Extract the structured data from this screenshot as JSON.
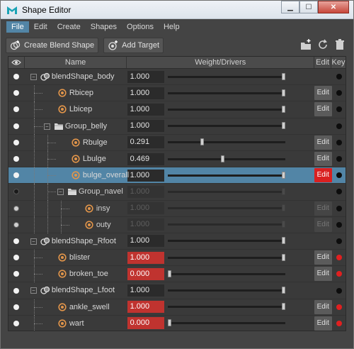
{
  "window": {
    "title": "Shape Editor"
  },
  "menu": [
    {
      "label": "File",
      "active": true
    },
    {
      "label": "Edit",
      "active": false
    },
    {
      "label": "Create",
      "active": false
    },
    {
      "label": "Shapes",
      "active": false
    },
    {
      "label": "Options",
      "active": false
    },
    {
      "label": "Help",
      "active": false
    }
  ],
  "toolbar": {
    "create_blend_shape": "Create Blend Shape",
    "add_target": "Add Target"
  },
  "columns": {
    "name": "Name",
    "weight": "Weight/Drivers",
    "edit": "Edit",
    "key": "Key"
  },
  "edit_label": "Edit",
  "rows": [
    {
      "name": "blendShape_body",
      "type": "blendshape",
      "depth": 0,
      "weight": "1.000",
      "slider": 1.0,
      "visible": "on",
      "edit": "none",
      "key": "black",
      "expand": "minus"
    },
    {
      "name": "Rbicep",
      "type": "target",
      "depth": 1,
      "weight": "1.000",
      "slider": 1.0,
      "visible": "on",
      "edit": "normal",
      "key": "black"
    },
    {
      "name": "Lbicep",
      "type": "target",
      "depth": 1,
      "weight": "1.000",
      "slider": 1.0,
      "visible": "on",
      "edit": "normal",
      "key": "black"
    },
    {
      "name": "Group_belly",
      "type": "group",
      "depth": 1,
      "weight": "1.000",
      "slider": 1.0,
      "visible": "on",
      "edit": "none",
      "key": "black",
      "expand": "minus"
    },
    {
      "name": "Rbulge",
      "type": "target",
      "depth": 2,
      "weight": "0.291",
      "slider": 0.291,
      "visible": "on",
      "edit": "normal",
      "key": "black"
    },
    {
      "name": "Lbulge",
      "type": "target",
      "depth": 2,
      "weight": "0.469",
      "slider": 0.469,
      "visible": "on",
      "edit": "normal",
      "key": "black"
    },
    {
      "name": "bulge_overall",
      "type": "target",
      "depth": 2,
      "weight": "1.000",
      "slider": 1.0,
      "visible": "on",
      "edit": "active",
      "key": "black",
      "selected": true
    },
    {
      "name": "Group_navel",
      "type": "group",
      "depth": 2,
      "weight": "1.000",
      "slider": 1.0,
      "visible": "off",
      "edit": "none",
      "key": "black",
      "expand": "minus",
      "disabled": true
    },
    {
      "name": "insy",
      "type": "target",
      "depth": 3,
      "weight": "1.000",
      "slider": 1.0,
      "visible": "half",
      "edit": "dim",
      "key": "black",
      "disabled": true
    },
    {
      "name": "outy",
      "type": "target",
      "depth": 3,
      "weight": "1.000",
      "slider": 1.0,
      "visible": "half",
      "edit": "dim",
      "key": "black",
      "disabled": true
    },
    {
      "name": "blendShape_Rfoot",
      "type": "blendshape",
      "depth": 0,
      "weight": "1.000",
      "slider": 1.0,
      "visible": "on",
      "edit": "none",
      "key": "black",
      "expand": "minus"
    },
    {
      "name": "blister",
      "type": "target",
      "depth": 1,
      "weight": "1.000",
      "slider": 1.0,
      "visible": "on",
      "edit": "normal",
      "key": "red",
      "weight_red": true
    },
    {
      "name": "broken_toe",
      "type": "target",
      "depth": 1,
      "weight": "0.000",
      "slider": 0.0,
      "visible": "on",
      "edit": "normal",
      "key": "red",
      "weight_red": true
    },
    {
      "name": "blendShape_Lfoot",
      "type": "blendshape",
      "depth": 0,
      "weight": "1.000",
      "slider": 1.0,
      "visible": "on",
      "edit": "none",
      "key": "black",
      "expand": "minus"
    },
    {
      "name": "ankle_swell",
      "type": "target",
      "depth": 1,
      "weight": "1.000",
      "slider": 1.0,
      "visible": "on",
      "edit": "normal",
      "key": "red",
      "weight_red": true
    },
    {
      "name": "wart",
      "type": "target",
      "depth": 1,
      "weight": "0.000",
      "slider": 0.0,
      "visible": "on",
      "edit": "normal",
      "key": "red",
      "weight_red": true
    }
  ]
}
